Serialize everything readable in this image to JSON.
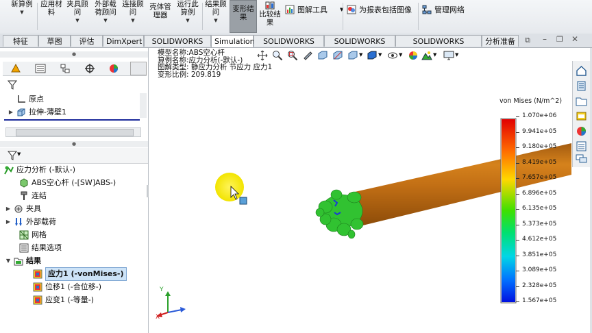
{
  "ribbon": {
    "buttons": [
      {
        "id": "new-study",
        "label": "新算例"
      },
      {
        "id": "apply-material",
        "label": "应用材\n料"
      },
      {
        "id": "fixtures-advisor",
        "label": "夹具顾\n问"
      },
      {
        "id": "external-loads-advisor",
        "label": "外部载\n荷顾问"
      },
      {
        "id": "connections-advisor",
        "label": "连接顾\n问"
      },
      {
        "id": "shell-manager",
        "label": "壳体管\n理器"
      },
      {
        "id": "run-study",
        "label": "运行此\n算例"
      },
      {
        "id": "results-advisor",
        "label": "结果顾\n问"
      },
      {
        "id": "deformed-result",
        "label": "变形结\n果"
      },
      {
        "id": "compare-results",
        "label": "比较结\n果"
      }
    ],
    "plot_tools": "图解工具",
    "include_image": "为报表包括图像",
    "manage_network": "管理网络"
  },
  "tabs": [
    "特征",
    "草图",
    "评估",
    "DimXpert",
    "SOLIDWORKS 插件",
    "Simulation",
    "SOLIDWORKS MBD",
    "SOLIDWORKS CAM",
    "SOLIDWORKS Inspection",
    "分析准备"
  ],
  "active_tab": "Simulation",
  "feature_tree": {
    "items": [
      {
        "label": "原点"
      },
      {
        "label": "拉伸-薄壁1"
      }
    ]
  },
  "sim_tree": {
    "root": "应力分析 (-默认-)",
    "part": "ABS空心杆 (-[SW]ABS-)",
    "connections": "连结",
    "fixtures": "夹具",
    "external_loads": "外部载荷",
    "mesh": "网格",
    "result_options": "结果选项",
    "results": "结果",
    "result_items": [
      {
        "label": "应力1 (-vonMises-)"
      },
      {
        "label": "位移1 (-合位移-)"
      },
      {
        "label": "应变1 (-等量-)"
      }
    ]
  },
  "viewport": {
    "info_lines": [
      "模型名称:ABS空心杆",
      "算例名称:应力分析(-默认-)",
      "图解类型: 静应力分析 节应力 应力1",
      "变形比例: 209.819"
    ],
    "legend_title": "von Mises (N/m^2)",
    "legend_ticks": [
      "1.070e+06",
      "9.941e+05",
      "9.180e+05",
      "8.419e+05",
      "7.657e+05",
      "6.896e+05",
      "6.135e+05",
      "5.373e+05",
      "4.612e+05",
      "3.851e+05",
      "3.089e+05",
      "2.328e+05",
      "1.567e+05"
    ],
    "axis_labels": {
      "x": "X",
      "y": "Y"
    }
  }
}
